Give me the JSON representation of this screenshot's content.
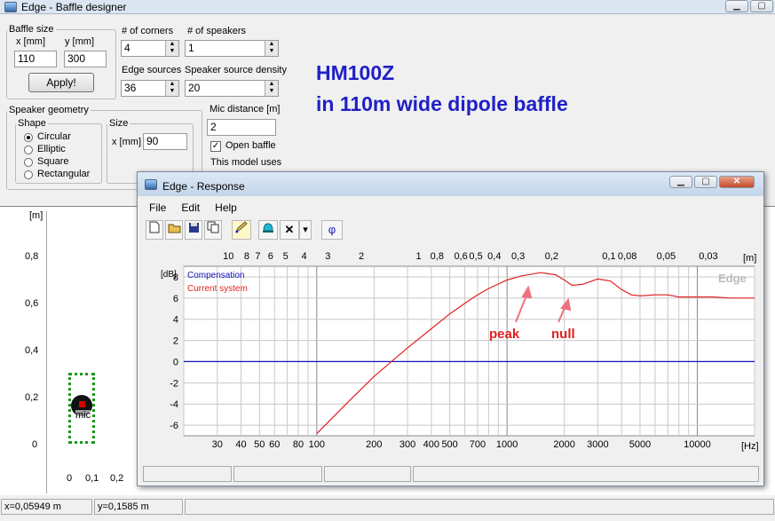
{
  "main_window": {
    "title": "Edge - Baffle designer"
  },
  "baffle_size": {
    "legend": "Baffle size",
    "x_label": "x [mm]",
    "y_label": "y [mm]",
    "x_value": "110",
    "y_value": "300",
    "apply_label": "Apply!"
  },
  "corners": {
    "label": "# of corners",
    "value": "4"
  },
  "speakers": {
    "label": "# of speakers",
    "value": "1"
  },
  "edge_sources": {
    "label": "Edge sources",
    "value": "36"
  },
  "density": {
    "label": "Speaker source density",
    "value": "20"
  },
  "annotation": {
    "line1": "HM100Z",
    "line2": "in 110m wide dipole baffle"
  },
  "geometry": {
    "legend": "Speaker geometry",
    "shape_legend": "Shape",
    "shapes": [
      "Circular",
      "Elliptic",
      "Square",
      "Rectangular"
    ],
    "selected": "Circular",
    "size_legend": "Size",
    "size_label": "x [mm]",
    "size_value": "90"
  },
  "mic": {
    "label": "Mic distance [m]",
    "value": "2",
    "open_baffle_label": "Open baffle",
    "open_baffle_checked": true,
    "note": "This model uses"
  },
  "baffle_view": {
    "unit": "[m]",
    "y_ticks": [
      "0,8",
      "0,6",
      "0,4",
      "0,2",
      "0"
    ],
    "x_ticks": [
      "0",
      "0,1",
      "0,2"
    ],
    "mic_label": "mic"
  },
  "status": {
    "x": "x=0,05949 m",
    "y": "y=0,1585 m"
  },
  "response_window": {
    "title": "Edge - Response",
    "menu": [
      "File",
      "Edit",
      "Help"
    ],
    "toolbar_icons": [
      "new-file-icon",
      "open-folder-icon",
      "save-icon",
      "copy-icon",
      "pencil-icon",
      "bell-icon",
      "delete-icon",
      "dropdown-icon",
      "phi-icon"
    ],
    "phi_label": "φ",
    "delete_label": "✕",
    "dropdown_label": "▾",
    "watermark": "Edge",
    "legend": {
      "compensation": "Compensation",
      "current": "Current system"
    },
    "callouts": {
      "peak": "peak",
      "null": "null"
    }
  },
  "chart_data": {
    "type": "line",
    "ylabel": "[dB]",
    "xlabel": "[Hz]",
    "top_axis_label": "[m]",
    "xscale": "log",
    "xlim": [
      20,
      20000
    ],
    "ylim": [
      -7,
      9
    ],
    "y_ticks": [
      8,
      6,
      4,
      2,
      0,
      -2,
      -4,
      -6
    ],
    "x_ticks": [
      30,
      40,
      50,
      60,
      80,
      100,
      200,
      300,
      400,
      500,
      700,
      1000,
      2000,
      3000,
      5000,
      10000
    ],
    "x_tick_labels": [
      "30",
      "40",
      "50",
      "60",
      "80",
      "100",
      "200",
      "300",
      "400",
      "500",
      "700",
      "1000",
      "2000",
      "3000",
      "5000",
      "10000"
    ],
    "top_ticks": [
      10,
      8,
      7,
      6,
      5,
      4,
      3,
      2,
      1,
      0.8,
      0.6,
      0.5,
      0.4,
      0.3,
      0.2,
      0.1,
      0.08,
      0.05,
      0.03
    ],
    "top_tick_labels": [
      "10",
      "8",
      "7",
      "6",
      "5",
      "4",
      "3",
      "2",
      "1",
      "0,8",
      "0,6",
      "0,5",
      "0,4",
      "0,3",
      "0,2",
      "0,1",
      "0,08",
      "0,05",
      "0,03"
    ],
    "grid": true,
    "legend_position": "top-left",
    "series": [
      {
        "name": "Compensation",
        "color": "#1010c0",
        "x": [
          20,
          20000
        ],
        "y": [
          0,
          0
        ]
      },
      {
        "name": "Current system",
        "color": "#e02020",
        "x": [
          100,
          150,
          200,
          300,
          400,
          500,
          600,
          700,
          800,
          1000,
          1200,
          1500,
          1800,
          2000,
          2200,
          2500,
          3000,
          3500,
          4000,
          4500,
          5000,
          6000,
          7000,
          8000,
          10000,
          12000,
          15000,
          20000
        ],
        "y": [
          -6.8,
          -3.6,
          -1.4,
          1.3,
          3.1,
          4.5,
          5.5,
          6.3,
          6.9,
          7.7,
          8.1,
          8.4,
          8.2,
          7.7,
          7.2,
          7.3,
          7.8,
          7.6,
          6.8,
          6.3,
          6.2,
          6.3,
          6.3,
          6.1,
          6.1,
          6.1,
          6.0,
          6.0
        ]
      }
    ]
  }
}
